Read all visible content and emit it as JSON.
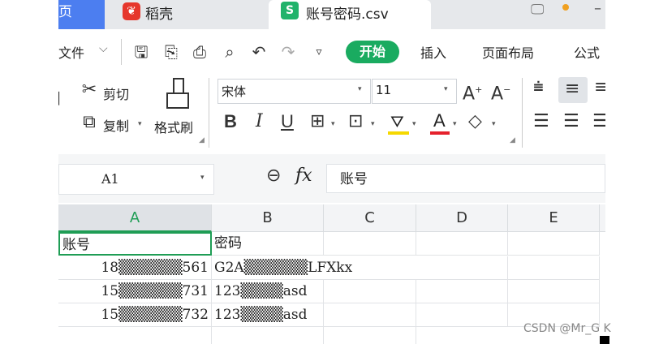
{
  "titlebar": {
    "home_tab": "页",
    "daoke_tab": "稻壳",
    "file_tab": "账号密码.csv",
    "file_logo": "S"
  },
  "menu": {
    "file": "文件",
    "start": "开始",
    "insert": "插入",
    "page_layout": "页面布局",
    "formula": "公式"
  },
  "ribbon": {
    "cut": "剪切",
    "copy": "复制",
    "format_painter": "格式刷",
    "font_name": "宋体",
    "font_size": "11"
  },
  "formula_bar": {
    "cell_ref": "A1",
    "fx": "fx",
    "content": "账号"
  },
  "grid": {
    "columns": [
      "A",
      "B",
      "C",
      "D",
      "E"
    ],
    "rows": [
      [
        "账号",
        "密码"
      ],
      [
        "18▒▒▒▒▒▒561",
        "G2A▒▒▒▒▒▒LFXkx"
      ],
      [
        "15▒▒▒▒▒▒731",
        "123▒▒▒▒asd"
      ],
      [
        "15▒▒▒▒▒▒732",
        "123▒▒▒▒asd"
      ]
    ]
  },
  "watermark": "CSDN @Mr_G K",
  "colors": {
    "accent_green": "#1aab60",
    "home_blue": "#4c7ef0",
    "daoke_red": "#e6372c"
  }
}
